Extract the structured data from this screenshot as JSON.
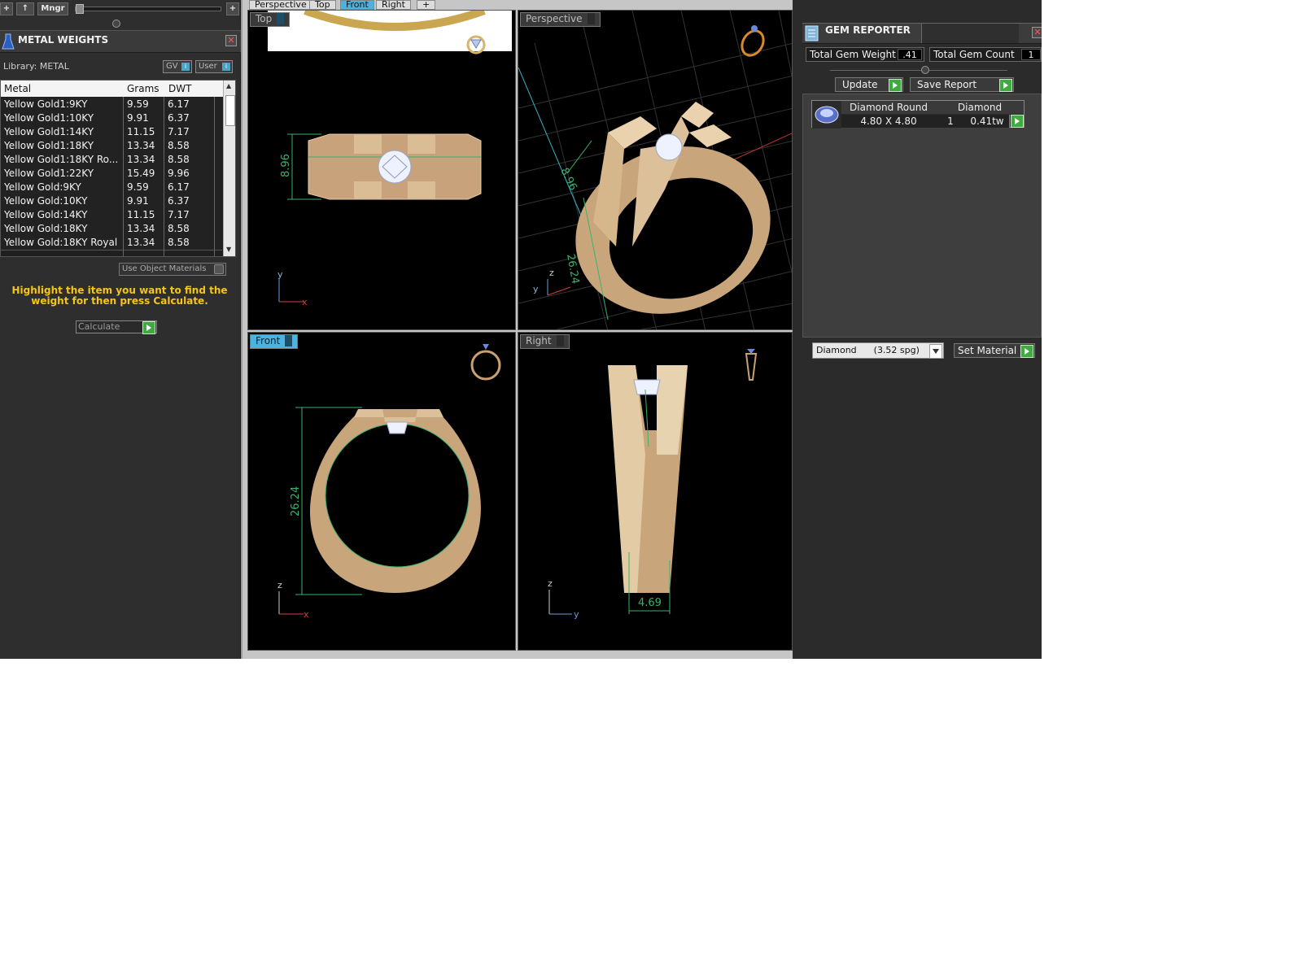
{
  "toolbar": {
    "add_label": "+",
    "up_label": "↑",
    "mngr_label": "Mngr",
    "plus_label": "+"
  },
  "metal_weights": {
    "title": "METAL WEIGHTS",
    "library": "Library: METAL",
    "gv_toggle": "GV",
    "user_toggle": "User",
    "columns": [
      "Metal",
      "Grams",
      "DWT"
    ],
    "rows": [
      [
        "Yellow Gold1:9KY",
        "9.59",
        "6.17"
      ],
      [
        "Yellow Gold1:10KY",
        "9.91",
        "6.37"
      ],
      [
        "Yellow Gold1:14KY",
        "11.15",
        "7.17"
      ],
      [
        "Yellow Gold1:18KY",
        "13.34",
        "8.58"
      ],
      [
        "Yellow Gold1:18KY Ro...",
        "13.34",
        "8.58"
      ],
      [
        "Yellow Gold1:22KY",
        "15.49",
        "9.96"
      ],
      [
        "Yellow Gold:9KY",
        "9.59",
        "6.17"
      ],
      [
        "Yellow Gold:10KY",
        "9.91",
        "6.37"
      ],
      [
        "Yellow Gold:14KY",
        "11.15",
        "7.17"
      ],
      [
        "Yellow Gold:18KY",
        "13.34",
        "8.58"
      ],
      [
        "Yellow Gold:18KY Royal",
        "13.34",
        "8.58"
      ]
    ],
    "use_object_materials": "Use Object Materials",
    "hint": "Highlight the item you want to find the weight for then press Calculate.",
    "calculate": "Calculate"
  },
  "viewport_tabs": [
    "Perspective",
    "Top",
    "Front",
    "Right",
    "+"
  ],
  "active_tab": "Front",
  "viewports": {
    "top": {
      "label": "Top",
      "dimension": "8.96"
    },
    "perspective": {
      "label": "Perspective",
      "dimension_a": "8.96",
      "dimension_b": "26.24"
    },
    "front": {
      "label": "Front",
      "dimension": "26.24"
    },
    "right": {
      "label": "Right",
      "dimension": "4.69"
    }
  },
  "gem_reporter": {
    "title": "GEM REPORTER",
    "total_weight_label": "Total Gem Weight",
    "total_weight_value": ".41",
    "total_count_label": "Total Gem Count",
    "total_count_value": "1",
    "update": "Update",
    "save_report": "Save Report",
    "gem": {
      "shape_header": "Diamond Round",
      "material_header": "Diamond",
      "size": "4.80 X 4.80",
      "count": "1",
      "weight": "0.41tw"
    },
    "material_select": "Diamond      (3.52 spg)",
    "set_material": "Set Material"
  },
  "colors": {
    "gold": "#d7b98f",
    "dimension_green": "#39b36b",
    "active_tab": "#4ab3e0",
    "hint_yellow": "#f5c518"
  }
}
